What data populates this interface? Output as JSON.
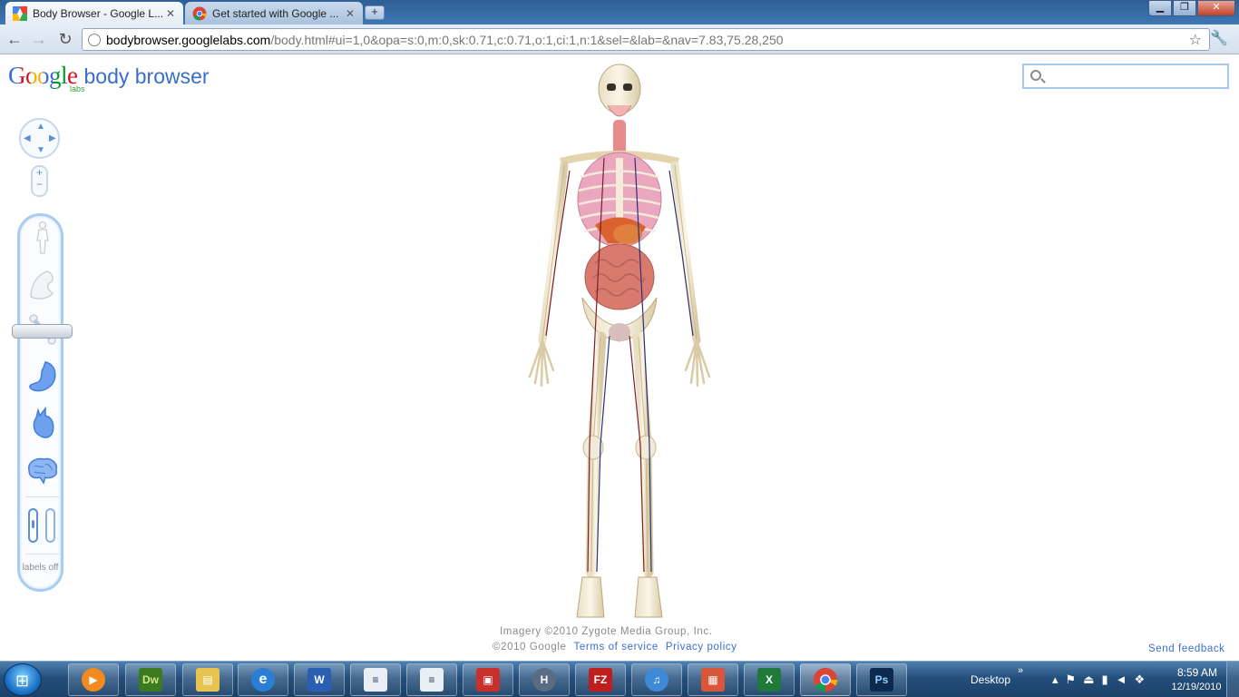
{
  "browser": {
    "tabs": [
      {
        "title": "Body Browser - Google L...",
        "active": true
      },
      {
        "title": "Get started with Google ...",
        "active": false
      }
    ],
    "url_host": "bodybrowser.googlelabs.com",
    "url_rest": "/body.html#ui=1,0&opa=s:0,m:0,sk:0.71,c:0.71,o:1,ci:1,n:1&sel=&lab=&nav=7.83,75.28,250"
  },
  "page": {
    "logo_word": "Google",
    "logo_sub": "labs",
    "product_name": "body browser",
    "search": {
      "placeholder": "",
      "value": ""
    },
    "layers": [
      "skin",
      "muscle",
      "skeleton",
      "organs",
      "circulatory",
      "nervous"
    ],
    "labels_text": "labels off",
    "footer": {
      "imagery": "Imagery ©2010 Zygote Media Group, Inc.",
      "copyright": "©2010 Google",
      "terms": "Terms of service",
      "privacy": "Privacy policy",
      "feedback": "Send feedback"
    }
  },
  "taskbar": {
    "apps": [
      "media-player",
      "dreamweaver",
      "explorer",
      "internet-explorer",
      "word",
      "notepad-1",
      "notepad-2",
      "packager",
      "hyperterminal",
      "filezilla",
      "itunes",
      "paint",
      "excel",
      "chrome",
      "photoshop"
    ],
    "tray_label": "Desktop",
    "time": "8:59 AM",
    "date": "12/19/2010"
  },
  "colors": {
    "google_blue": "#3a6dcb",
    "panel_border": "#a8cdf2",
    "taskbar": "#244f7b"
  }
}
